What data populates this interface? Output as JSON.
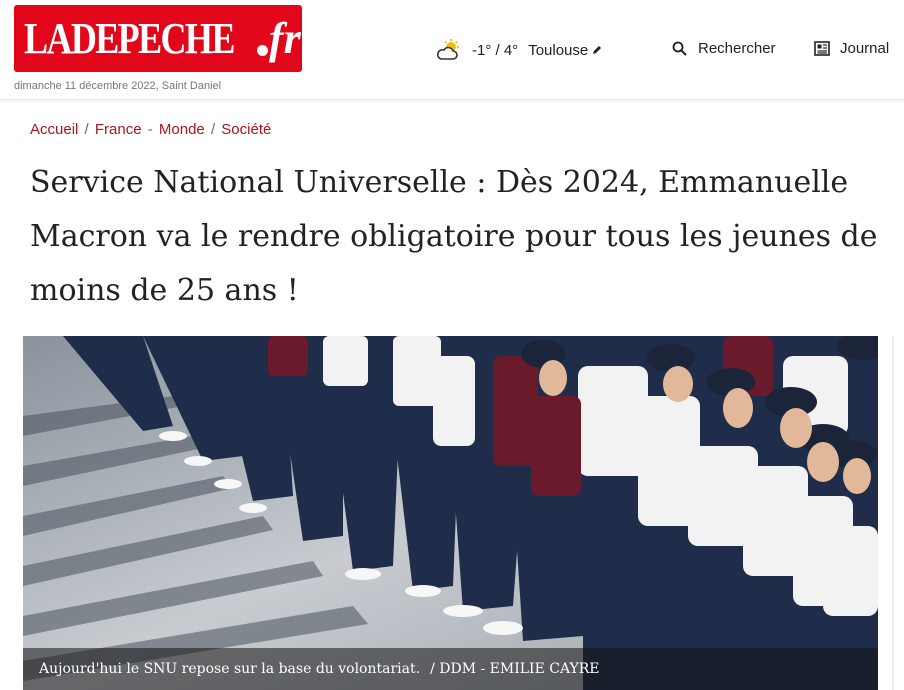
{
  "header": {
    "logo_word": "LADEPECHE",
    "logo_tld": "fr",
    "date_line": "dimanche 11 décembre 2022, Saint Daniel",
    "weather": {
      "icon": "partly-cloudy-icon",
      "temperature": "-1° / 4°",
      "city": "Toulouse",
      "edit_icon": "pencil-icon"
    },
    "search": {
      "icon": "search-icon",
      "label": "Rechercher"
    },
    "journal": {
      "icon": "newspaper-icon",
      "label": "Journal"
    },
    "colors": {
      "brand_red": "#e2061b"
    }
  },
  "breadcrumb": {
    "items": [
      "Accueil",
      "France",
      "Monde",
      "Société"
    ],
    "separators": [
      "/",
      "-",
      "/"
    ]
  },
  "article": {
    "title": "Service National Universelle : Dès 2024, Emmanuelle Macron va le rendre obligatoire pour tous les jeunes de moins de 25 ans !",
    "image": {
      "description_icon": "photo-young-people-in-line",
      "caption": "Aujourd'hui le SNU repose sur la base du volontariat.",
      "credit": "/ DDM - EMILIE CAYRE"
    }
  }
}
